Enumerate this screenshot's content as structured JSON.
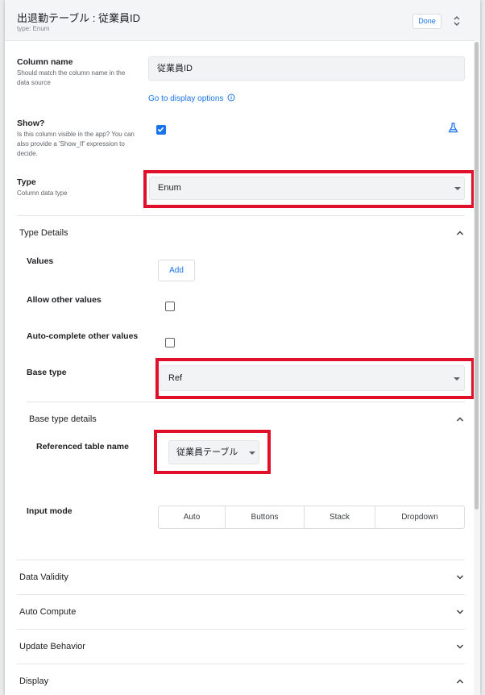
{
  "header": {
    "title": "出退勤テーブル : 従業員ID",
    "subtitle": "type: Enum",
    "done_label": "Done"
  },
  "column_name": {
    "label": "Column name",
    "help": "Should match the column name in the data source",
    "value": "従業員ID",
    "link": "Go to display options"
  },
  "show": {
    "label": "Show?",
    "help": "Is this column visible in the app? You can also provide a 'Show_If' expression to decide.",
    "checked": true
  },
  "type": {
    "label": "Type",
    "help": "Column data type",
    "value": "Enum"
  },
  "type_details": {
    "title": "Type Details",
    "values_label": "Values",
    "add_label": "Add",
    "allow_other_label": "Allow other values",
    "autocomplete_label": "Auto-complete other values",
    "base_type_label": "Base type",
    "base_type_value": "Ref",
    "base_type_details_title": "Base type details",
    "referenced_table_label": "Referenced table name",
    "referenced_table_value": "従業員テーブル",
    "input_mode_label": "Input mode",
    "input_modes": [
      "Auto",
      "Buttons",
      "Stack",
      "Dropdown"
    ]
  },
  "sections": [
    {
      "title": "Data Validity",
      "expanded": false
    },
    {
      "title": "Auto Compute",
      "expanded": false
    },
    {
      "title": "Update Behavior",
      "expanded": false
    },
    {
      "title": "Display",
      "expanded": true
    }
  ],
  "colors": {
    "accent": "#1a73e8",
    "highlight": "#e0102b"
  }
}
